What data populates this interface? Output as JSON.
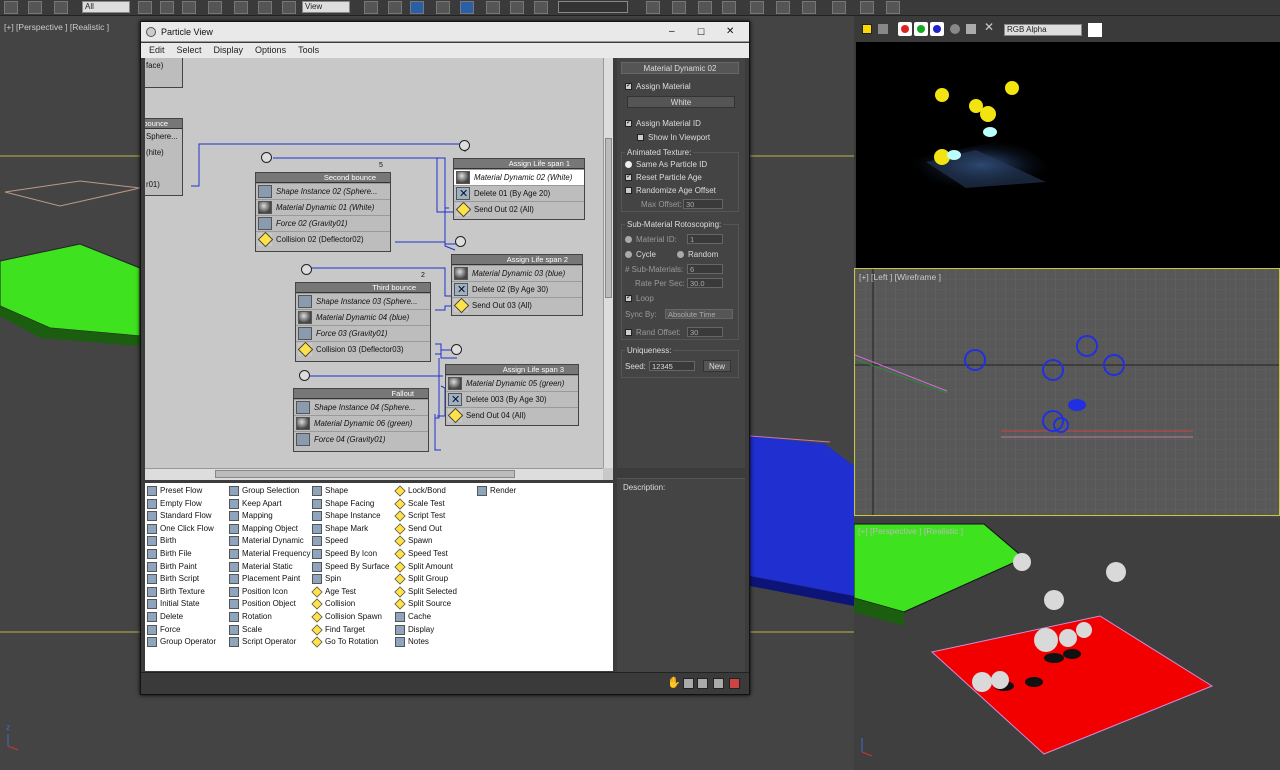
{
  "toolbar": {
    "filter_value": "All",
    "view_value": "View",
    "channel_value": "RGB Alpha"
  },
  "viewports": {
    "top_left": "[+] [Perspective ] [Realistic ]",
    "right_middle": "[+] [Left ] [Wireframe ]",
    "right_bottom": "[+] [Perspective ] [Realistic ]"
  },
  "particle_view": {
    "title": "Particle View",
    "window_controls": [
      "–",
      "☐",
      "✕"
    ],
    "menu": [
      "Edit",
      "Select",
      "Display",
      "Options",
      "Tools"
    ],
    "nodes": {
      "partial_top": {
        "rows": [
          "face)"
        ]
      },
      "partial_bounce": {
        "title": "bounce",
        "rows": [
          "Sphere...",
          "(hite)",
          "",
          "r01)"
        ]
      },
      "second_bounce": {
        "title": "Second bounce",
        "count": "5",
        "rows": [
          "Shape Instance 02 (Sphere...",
          "Material Dynamic 01 (White)",
          "Force 02 (Gravity01)",
          "Collision 02 (Deflector02)"
        ]
      },
      "assign_1": {
        "title": "Assign Life span 1",
        "rows": [
          "Material Dynamic 02 (White)",
          "Delete 01 (By Age 20)",
          "Send Out 02 (All)"
        ]
      },
      "third_bounce": {
        "title": "Third bounce",
        "count": "2",
        "rows": [
          "Shape Instance 03 (Sphere...",
          "Material Dynamic 04 (blue)",
          "Force 03 (Gravity01)",
          "Collision 03 (Deflector03)"
        ]
      },
      "assign_2": {
        "title": "Assign Life span 2",
        "rows": [
          "Material Dynamic 03 (blue)",
          "Delete 02 (By Age 30)",
          "Send Out 03 (All)"
        ]
      },
      "fallout": {
        "title": "Fallout",
        "rows": [
          "Shape Instance 04 (Sphere...",
          "Material Dynamic 06 (green)",
          "Force 04 (Gravity01)"
        ]
      },
      "assign_3": {
        "title": "Assign Life span 3",
        "rows": [
          "Material Dynamic 05 (green)",
          "Delete 003 (By Age 30)",
          "Send Out 04 (All)"
        ]
      }
    },
    "params": {
      "rollout_title": "Material Dynamic 02",
      "assign_material": "Assign Material",
      "material_name": "White",
      "assign_material_id": "Assign Material ID",
      "show_in_viewport": "Show In Viewport",
      "animated_texture": "Animated Texture:",
      "same_as_particle_id": "Same As Particle ID",
      "reset_particle_age": "Reset Particle Age",
      "randomize_age_offset": "Randomize Age Offset",
      "max_offset_label": "Max Offset:",
      "max_offset_value": "30",
      "sub_material_roto": "Sub-Material Rotoscoping:",
      "material_id_label": "Material ID:",
      "material_id_value": "1",
      "cycle": "Cycle",
      "random": "Random",
      "sub_materials_label": "# Sub-Materials:",
      "sub_materials_value": "6",
      "rate_label": "Rate Per Sec:",
      "rate_value": "30.0",
      "loop": "Loop",
      "sync_by_label": "Sync By:",
      "sync_by_value": "Absolute Time",
      "rand_offset_label": "Rand Offset:",
      "rand_offset_value": "30",
      "uniqueness": "Uniqueness:",
      "seed_label": "Seed:",
      "seed_value": "12345",
      "new_button": "New",
      "description": "Description:"
    },
    "depot": [
      [
        "Preset Flow",
        "Empty Flow",
        "Standard Flow",
        "One Click Flow",
        "Birth",
        "Birth File",
        "Birth Paint",
        "Birth Script",
        "Birth Texture",
        "Initial State",
        "Delete",
        "Force",
        "Group Operator"
      ],
      [
        "Group Selection",
        "Keep Apart",
        "Mapping",
        "Mapping Object",
        "Material Dynamic",
        "Material Frequency",
        "Material Static",
        "Placement Paint",
        "Position Icon",
        "Position Object",
        "Rotation",
        "Scale",
        "Script Operator"
      ],
      [
        "Shape",
        "Shape Facing",
        "Shape Instance",
        "Shape Mark",
        "Speed",
        "Speed By Icon",
        "Speed By Surface",
        "Spin",
        "Age Test",
        "Collision",
        "Collision Spawn",
        "Find Target",
        "Go To Rotation"
      ],
      [
        "Lock/Bond",
        "Scale Test",
        "Script Test",
        "Send Out",
        "Spawn",
        "Speed Test",
        "Split Amount",
        "Split Group",
        "Split Selected",
        "Split Source",
        "Cache",
        "Display",
        "Notes"
      ],
      [
        "Render"
      ]
    ]
  },
  "colors": {
    "accent_blue": "#1f2fd0",
    "node_header": "#777777",
    "test_yellow": "#ffe14a"
  }
}
